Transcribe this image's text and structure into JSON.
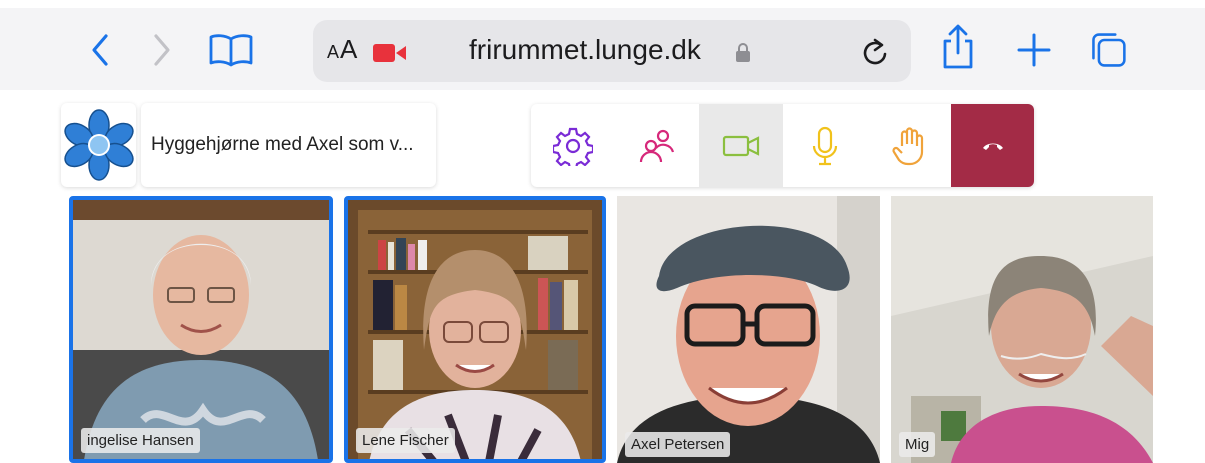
{
  "browser": {
    "text_size_label_small": "A",
    "text_size_label_large": "A",
    "url": "frirummet.lunge.dk",
    "icons": [
      "back-icon",
      "forward-icon",
      "bookmarks-icon",
      "camera-icon",
      "lock-icon",
      "reload-icon",
      "share-icon",
      "new-tab-icon",
      "tabs-icon"
    ]
  },
  "meeting": {
    "title": "Hyggehjørne med Axel som v...",
    "controls": [
      "settings-icon",
      "participants-icon",
      "camera-icon",
      "microphone-icon",
      "raise-hand-icon",
      "hang-up-icon"
    ],
    "colors": {
      "speaking_border": "#1a73e8",
      "hangup": "#a32b46",
      "settings": "#7a2bd6",
      "participants": "#d6287a",
      "camera": "#8bbf3f",
      "mic": "#f1c21b",
      "hand": "#f0a33a"
    }
  },
  "participants": [
    {
      "name": "ingelise Hansen",
      "speaking": true
    },
    {
      "name": "Lene Fischer",
      "speaking": true
    },
    {
      "name": "Axel Petersen",
      "speaking": false
    },
    {
      "name": "Mig",
      "speaking": false
    }
  ]
}
